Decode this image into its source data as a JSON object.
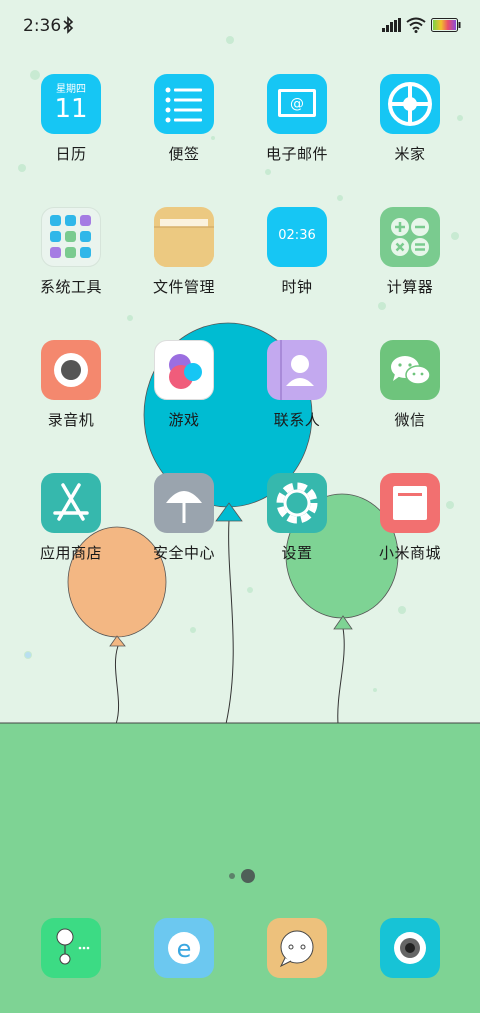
{
  "status_bar": {
    "time": "2:36",
    "icons": [
      "bluetooth-icon",
      "signal-icon",
      "wifi-icon",
      "battery-icon"
    ]
  },
  "apps": [
    {
      "id": "calendar",
      "label": "日历",
      "icon": "calendar-icon",
      "color": "#16c6f4",
      "weekday": "星期四",
      "date": "11"
    },
    {
      "id": "notes",
      "label": "便签",
      "icon": "notes-list-icon",
      "color": "#16c6f4"
    },
    {
      "id": "email",
      "label": "电子邮件",
      "icon": "email-icon",
      "color": "#16c6f4"
    },
    {
      "id": "mijia",
      "label": "米家",
      "icon": "mijia-icon",
      "color": "#16c6f4"
    },
    {
      "id": "tools",
      "label": "系统工具",
      "icon": "tools-folder-icon",
      "color": "#eaf4ee"
    },
    {
      "id": "files",
      "label": "文件管理",
      "icon": "folder-icon",
      "color": "#ecc981"
    },
    {
      "id": "clock",
      "label": "时钟",
      "icon": "clock-icon",
      "color": "#16c6f4",
      "clock_text": "02:36"
    },
    {
      "id": "calculator",
      "label": "计算器",
      "icon": "calculator-icon",
      "color": "#7acb8f"
    },
    {
      "id": "recorder",
      "label": "录音机",
      "icon": "recorder-icon",
      "color": "#f4886e"
    },
    {
      "id": "games",
      "label": "游戏",
      "icon": "games-icon",
      "color": "#ffffff"
    },
    {
      "id": "contacts",
      "label": "联系人",
      "icon": "contacts-icon",
      "color": "#c3a9ef"
    },
    {
      "id": "wechat",
      "label": "微信",
      "icon": "wechat-icon",
      "color": "#6ec47c"
    },
    {
      "id": "appstore",
      "label": "应用商店",
      "icon": "appstore-icon",
      "color": "#36b8ad"
    },
    {
      "id": "security",
      "label": "安全中心",
      "icon": "umbrella-icon",
      "color": "#9aa4ae"
    },
    {
      "id": "settings",
      "label": "设置",
      "icon": "gear-icon",
      "color": "#36b8ad"
    },
    {
      "id": "mistore",
      "label": "小米商城",
      "icon": "mistore-icon",
      "color": "#f27070"
    }
  ],
  "page_indicator": {
    "pages": 2,
    "current": 2
  },
  "dock": [
    {
      "id": "phone",
      "icon": "phone-icon",
      "color": "#3cdb84"
    },
    {
      "id": "browser",
      "icon": "browser-icon",
      "color": "#6cc8f0"
    },
    {
      "id": "messages",
      "icon": "messages-icon",
      "color": "#edc17c"
    },
    {
      "id": "camera",
      "icon": "camera-icon",
      "color": "#17c3d6"
    }
  ]
}
